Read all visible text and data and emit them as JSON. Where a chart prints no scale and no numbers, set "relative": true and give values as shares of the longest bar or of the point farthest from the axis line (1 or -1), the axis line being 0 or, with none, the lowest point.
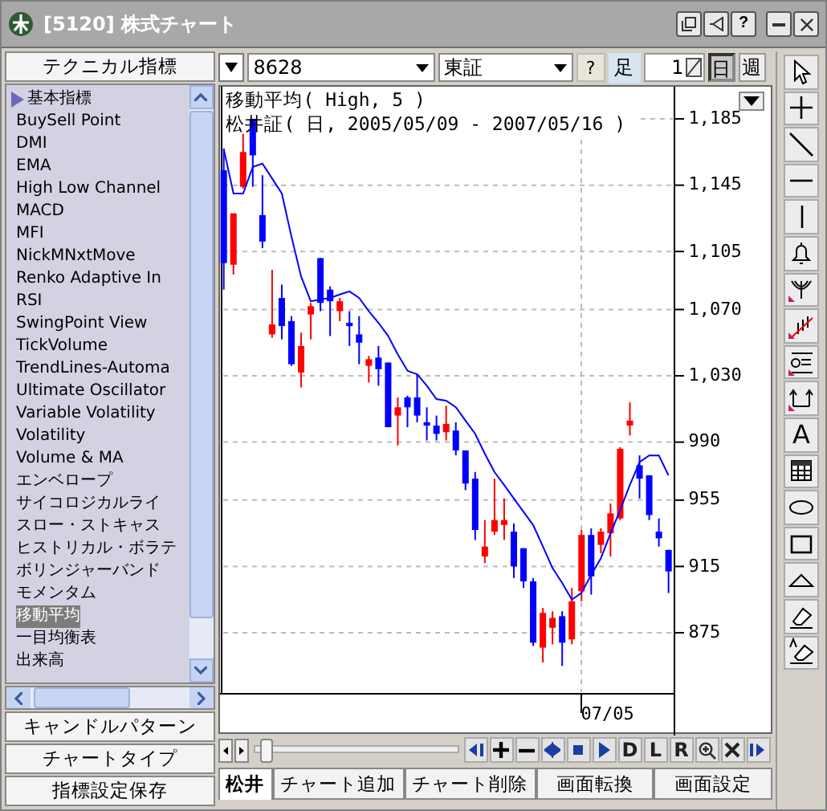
{
  "window": {
    "title": "[5120] 株式チャート",
    "help_glyph": "?"
  },
  "indicator_panel": {
    "header": "テクニカル指標",
    "items": [
      {
        "label": "基本指標",
        "kind": "group",
        "selected": false
      },
      {
        "label": "BuySell Point",
        "kind": "item",
        "selected": false
      },
      {
        "label": "DMI",
        "kind": "item",
        "selected": false
      },
      {
        "label": "EMA",
        "kind": "item",
        "selected": false
      },
      {
        "label": "High Low Channel",
        "kind": "item",
        "selected": false
      },
      {
        "label": "MACD",
        "kind": "item",
        "selected": false
      },
      {
        "label": "MFI",
        "kind": "item",
        "selected": false
      },
      {
        "label": "NickMNxtMove",
        "kind": "item",
        "selected": false
      },
      {
        "label": "Renko Adaptive In",
        "kind": "item",
        "selected": false
      },
      {
        "label": "RSI",
        "kind": "item",
        "selected": false
      },
      {
        "label": "SwingPoint View",
        "kind": "item",
        "selected": false
      },
      {
        "label": "TickVolume",
        "kind": "item",
        "selected": false
      },
      {
        "label": "TrendLines-Automa",
        "kind": "item",
        "selected": false
      },
      {
        "label": "Ultimate Oscillator",
        "kind": "item",
        "selected": false
      },
      {
        "label": "Variable Volatility",
        "kind": "item",
        "selected": false
      },
      {
        "label": "Volatility",
        "kind": "item",
        "selected": false
      },
      {
        "label": "Volume & MA",
        "kind": "item",
        "selected": false
      },
      {
        "label": "エンベロープ",
        "kind": "item",
        "selected": false
      },
      {
        "label": "サイコロジカルライ",
        "kind": "item",
        "selected": false
      },
      {
        "label": "スロー・ストキャス",
        "kind": "item",
        "selected": false
      },
      {
        "label": "ヒストリカル・ボラテ",
        "kind": "item",
        "selected": false
      },
      {
        "label": "ボリンジャーバンド",
        "kind": "item",
        "selected": false
      },
      {
        "label": "モメンタム",
        "kind": "item",
        "selected": false
      },
      {
        "label": "移動平均",
        "kind": "item",
        "selected": true
      },
      {
        "label": "一目均衡表",
        "kind": "item",
        "selected": false
      },
      {
        "label": "出来高",
        "kind": "item",
        "selected": false
      }
    ]
  },
  "panel_buttons": [
    "キャンドルパターン",
    "チャートタイプ",
    "指標設定保存"
  ],
  "toolbar": {
    "symbol": "8628",
    "market": "東証",
    "help": "?",
    "bar_label": "足",
    "bar_count": "1",
    "periods": [
      {
        "label": "日",
        "selected": true
      },
      {
        "label": "週",
        "selected": false
      }
    ]
  },
  "chart": {
    "lines": [
      "松井証( 日, 2005/05/09 - 2007/05/16 )"
    ],
    "x_axis_label": "07/05",
    "chart_data": {
      "type": "candlestick",
      "categories": [
        null,
        null,
        null,
        null,
        null,
        null,
        null,
        null,
        null,
        null,
        null,
        null,
        null,
        null,
        null,
        null,
        null,
        null,
        null,
        null,
        null,
        null,
        null,
        null,
        null,
        null,
        null,
        null,
        null,
        null,
        null,
        null,
        null,
        null,
        null,
        null,
        null,
        null,
        null,
        null,
        null,
        null,
        null,
        null,
        null,
        null,
        null
      ],
      "ohlc": [
        [
          1154,
          1167,
          1082,
          1098
        ],
        [
          1097,
          1128,
          1091,
          1128
        ],
        [
          1144,
          1176,
          1143,
          1165
        ],
        [
          1185,
          1185,
          1144,
          1163
        ],
        [
          1127,
          1151,
          1107,
          1111
        ],
        [
          1055,
          1094,
          1053,
          1061
        ],
        [
          1077,
          1085,
          1052,
          1060
        ],
        [
          1063,
          1066,
          1036,
          1037
        ],
        [
          1032,
          1056,
          1023,
          1048
        ],
        [
          1067,
          1074,
          1052,
          1072
        ],
        [
          1101,
          1101,
          1069,
          1074
        ],
        [
          1082,
          1084,
          1054,
          1075
        ],
        [
          1069,
          1077,
          1063,
          1075
        ],
        [
          1062,
          1069,
          1048,
          1060
        ],
        [
          1055,
          1066,
          1037,
          1050
        ],
        [
          1036,
          1042,
          1026,
          1040
        ],
        [
          1041,
          1048,
          1024,
          1034
        ],
        [
          1038,
          1038,
          999,
          999
        ],
        [
          1006,
          1017,
          988,
          1011
        ],
        [
          1017,
          1018,
          999,
          1011
        ],
        [
          1017,
          1031,
          1002,
          1006
        ],
        [
          1002,
          1011,
          991,
          1000
        ],
        [
          1000,
          1006,
          991,
          995
        ],
        [
          996,
          1012,
          991,
          1001
        ],
        [
          997,
          1002,
          982,
          985
        ],
        [
          985,
          985,
          961,
          965
        ],
        [
          968,
          972,
          931,
          937
        ],
        [
          921,
          943,
          917,
          927
        ],
        [
          936,
          968,
          934,
          943
        ],
        [
          940,
          956,
          931,
          943
        ],
        [
          936,
          941,
          908,
          915
        ],
        [
          926,
          926,
          902,
          906
        ],
        [
          906,
          908,
          867,
          869
        ],
        [
          866,
          890,
          857,
          887
        ],
        [
          878,
          888,
          868,
          884
        ],
        [
          885,
          888,
          855,
          869
        ],
        [
          871,
          902,
          868,
          894
        ],
        [
          900,
          937,
          894,
          934
        ],
        [
          934,
          938,
          898,
          909
        ],
        [
          928,
          938,
          923,
          936
        ],
        [
          935,
          953,
          921,
          947
        ],
        [
          944,
          987,
          943,
          986
        ],
        [
          1000,
          1014,
          994,
          1003
        ],
        [
          976,
          982,
          956,
          968
        ],
        [
          970,
          970,
          943,
          946
        ],
        [
          936,
          944,
          927,
          932
        ],
        [
          925,
          925,
          899,
          912
        ]
      ],
      "grid": true,
      "ylim": [
        838.2,
        1204.4
      ],
      "yticks": [
        {
          "value": 1185,
          "label": "1,185"
        },
        {
          "value": 1145,
          "label": "1,145"
        },
        {
          "value": 1105,
          "label": "1,105"
        },
        {
          "value": 1070,
          "label": "1,070"
        },
        {
          "value": 1030,
          "label": "1,030"
        },
        {
          "value": 990,
          "label": "990"
        },
        {
          "value": 955,
          "label": "955"
        },
        {
          "value": 915,
          "label": "915"
        },
        {
          "value": 875,
          "label": "875"
        }
      ]
    },
    "overlay": {
      "chart_data": {
        "type": "line",
        "relative": true,
        "categories": [
          null,
          null,
          null,
          null,
          null,
          null,
          null,
          null,
          null,
          null,
          null,
          null,
          null,
          null,
          null,
          null,
          null,
          null,
          null,
          null,
          null,
          null,
          null,
          null,
          null,
          null,
          null,
          null,
          null,
          null,
          null,
          null,
          null,
          null,
          null,
          null,
          null,
          null,
          null,
          null,
          null,
          null,
          null,
          null,
          null,
          null,
          null
        ],
        "series": [
          {
            "name": "移動平均( High, 5 )",
            "color": "#0000ff",
            "values": [
              1167,
              1140,
              1140,
              1156,
              1158,
              1149,
              1140,
              1114,
              1090,
              1075,
              1076,
              1077,
              1079,
              1081,
              1077,
              1069,
              1062,
              1054,
              1043,
              1033,
              1031,
              1024,
              1016,
              1015,
              1011,
              1003,
              995,
              983,
              972,
              964,
              956,
              948,
              940,
              927,
              914,
              905,
              895,
              899,
              910,
              920,
              935,
              949,
              964,
              978,
              982,
              982,
              970
            ]
          }
        ],
        "ylim": [
          838.2,
          1204.4
        ]
      }
    }
  },
  "navigator": {
    "level": 0.05,
    "letters": [
      "D",
      "L",
      "R"
    ]
  },
  "text_tool_glyph": "A",
  "tabs": [
    {
      "label": "松井",
      "selected": true
    },
    {
      "label": "チャート追加",
      "selected": false
    },
    {
      "label": "チャート削除",
      "selected": false
    },
    {
      "label": "画面転換",
      "selected": false
    },
    {
      "label": "画面設定",
      "selected": false
    }
  ]
}
